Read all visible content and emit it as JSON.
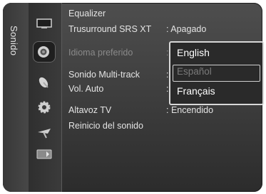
{
  "sidebar": {
    "label": "Sonido"
  },
  "menu": {
    "items": [
      {
        "label": "Equalizer",
        "value": ""
      },
      {
        "label": "Trusurround SRS XT",
        "value": ": Apagado"
      },
      {
        "label": "Idioma preferido",
        "value": ":"
      },
      {
        "label": "Sonido Multi-track",
        "value": ":"
      },
      {
        "label": "Vol. Auto",
        "value": ":"
      },
      {
        "label": "Altavoz TV",
        "value": ": Encendido"
      },
      {
        "label": "Reinicio del sonido",
        "value": ""
      }
    ]
  },
  "dropdown": {
    "options": [
      {
        "label": "English",
        "state": "selected"
      },
      {
        "label": "Español",
        "state": "disabled"
      },
      {
        "label": "Français",
        "state": "normal"
      }
    ]
  },
  "icons": [
    "tv-icon",
    "speaker-icon",
    "satellite-dish-icon",
    "gear-icon",
    "antenna-icon",
    "input-icon"
  ],
  "colors": {
    "panel": "#3f3f3f",
    "text": "#e4e4e4",
    "dim_text": "#8a8a8a",
    "dropdown_border": "#d8d8d8"
  }
}
